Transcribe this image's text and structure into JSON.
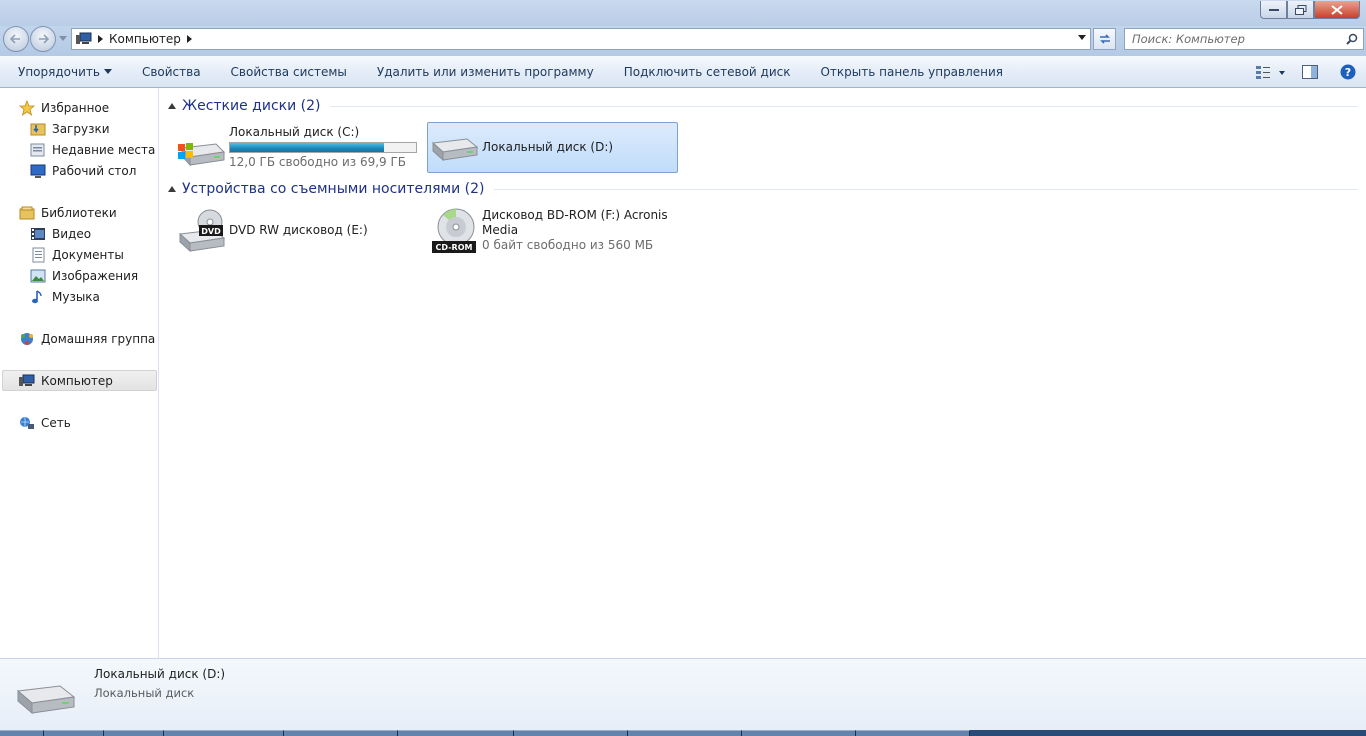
{
  "window": {
    "caption_buttons": [
      "minimize",
      "maximize",
      "close"
    ]
  },
  "address": {
    "crumbs": [
      "Компьютер"
    ],
    "search_placeholder": "Поиск: Компьютер"
  },
  "toolbar": {
    "organize": "Упорядочить",
    "properties": "Свойства",
    "system_properties": "Свойства системы",
    "uninstall": "Удалить или изменить программу",
    "map_drive": "Подключить сетевой диск",
    "control_panel": "Открыть панель управления"
  },
  "sidebar": {
    "favorites": "Избранное",
    "downloads": "Загрузки",
    "recent": "Недавние места",
    "desktop": "Рабочий стол",
    "libraries": "Библиотеки",
    "video": "Видео",
    "documents": "Документы",
    "pictures": "Изображения",
    "music": "Музыка",
    "homegroup": "Домашняя группа",
    "computer": "Компьютер",
    "network": "Сеть"
  },
  "groups": {
    "hard_disks": "Жесткие диски (2)",
    "removable": "Устройства со съемными носителями (2)"
  },
  "drives": {
    "c": {
      "name": "Локальный диск (C:)",
      "free": "12,0 ГБ свободно из 69,9 ГБ",
      "used_fraction": 0.828
    },
    "d": {
      "name": "Локальный диск (D:)"
    },
    "e": {
      "name": "DVD RW дисковод (E:)",
      "badge": "DVD"
    },
    "f": {
      "name_line1": "Дисковод BD-ROM (F:) Acronis",
      "name_line2": "Media",
      "free": "0 байт свободно из 560 МБ",
      "badge": "CD-ROM"
    }
  },
  "details": {
    "name": "Локальный диск (D:)",
    "type": "Локальный диск"
  },
  "colors": {
    "accent": "#1e3287",
    "selection": "#c1dcfa",
    "progress": "#1b86b8"
  }
}
